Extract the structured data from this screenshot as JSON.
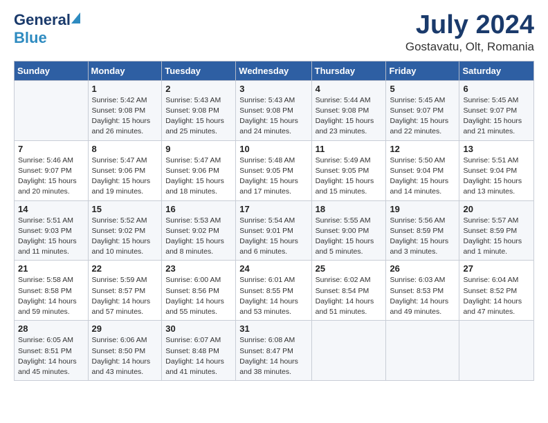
{
  "header": {
    "logo_general": "General",
    "logo_blue": "Blue",
    "title": "July 2024",
    "subtitle": "Gostavatu, Olt, Romania"
  },
  "calendar": {
    "days_of_week": [
      "Sunday",
      "Monday",
      "Tuesday",
      "Wednesday",
      "Thursday",
      "Friday",
      "Saturday"
    ],
    "weeks": [
      [
        {
          "day": "",
          "info": ""
        },
        {
          "day": "1",
          "info": "Sunrise: 5:42 AM\nSunset: 9:08 PM\nDaylight: 15 hours\nand 26 minutes."
        },
        {
          "day": "2",
          "info": "Sunrise: 5:43 AM\nSunset: 9:08 PM\nDaylight: 15 hours\nand 25 minutes."
        },
        {
          "day": "3",
          "info": "Sunrise: 5:43 AM\nSunset: 9:08 PM\nDaylight: 15 hours\nand 24 minutes."
        },
        {
          "day": "4",
          "info": "Sunrise: 5:44 AM\nSunset: 9:08 PM\nDaylight: 15 hours\nand 23 minutes."
        },
        {
          "day": "5",
          "info": "Sunrise: 5:45 AM\nSunset: 9:07 PM\nDaylight: 15 hours\nand 22 minutes."
        },
        {
          "day": "6",
          "info": "Sunrise: 5:45 AM\nSunset: 9:07 PM\nDaylight: 15 hours\nand 21 minutes."
        }
      ],
      [
        {
          "day": "7",
          "info": "Sunrise: 5:46 AM\nSunset: 9:07 PM\nDaylight: 15 hours\nand 20 minutes."
        },
        {
          "day": "8",
          "info": "Sunrise: 5:47 AM\nSunset: 9:06 PM\nDaylight: 15 hours\nand 19 minutes."
        },
        {
          "day": "9",
          "info": "Sunrise: 5:47 AM\nSunset: 9:06 PM\nDaylight: 15 hours\nand 18 minutes."
        },
        {
          "day": "10",
          "info": "Sunrise: 5:48 AM\nSunset: 9:05 PM\nDaylight: 15 hours\nand 17 minutes."
        },
        {
          "day": "11",
          "info": "Sunrise: 5:49 AM\nSunset: 9:05 PM\nDaylight: 15 hours\nand 15 minutes."
        },
        {
          "day": "12",
          "info": "Sunrise: 5:50 AM\nSunset: 9:04 PM\nDaylight: 15 hours\nand 14 minutes."
        },
        {
          "day": "13",
          "info": "Sunrise: 5:51 AM\nSunset: 9:04 PM\nDaylight: 15 hours\nand 13 minutes."
        }
      ],
      [
        {
          "day": "14",
          "info": "Sunrise: 5:51 AM\nSunset: 9:03 PM\nDaylight: 15 hours\nand 11 minutes."
        },
        {
          "day": "15",
          "info": "Sunrise: 5:52 AM\nSunset: 9:02 PM\nDaylight: 15 hours\nand 10 minutes."
        },
        {
          "day": "16",
          "info": "Sunrise: 5:53 AM\nSunset: 9:02 PM\nDaylight: 15 hours\nand 8 minutes."
        },
        {
          "day": "17",
          "info": "Sunrise: 5:54 AM\nSunset: 9:01 PM\nDaylight: 15 hours\nand 6 minutes."
        },
        {
          "day": "18",
          "info": "Sunrise: 5:55 AM\nSunset: 9:00 PM\nDaylight: 15 hours\nand 5 minutes."
        },
        {
          "day": "19",
          "info": "Sunrise: 5:56 AM\nSunset: 8:59 PM\nDaylight: 15 hours\nand 3 minutes."
        },
        {
          "day": "20",
          "info": "Sunrise: 5:57 AM\nSunset: 8:59 PM\nDaylight: 15 hours\nand 1 minute."
        }
      ],
      [
        {
          "day": "21",
          "info": "Sunrise: 5:58 AM\nSunset: 8:58 PM\nDaylight: 14 hours\nand 59 minutes."
        },
        {
          "day": "22",
          "info": "Sunrise: 5:59 AM\nSunset: 8:57 PM\nDaylight: 14 hours\nand 57 minutes."
        },
        {
          "day": "23",
          "info": "Sunrise: 6:00 AM\nSunset: 8:56 PM\nDaylight: 14 hours\nand 55 minutes."
        },
        {
          "day": "24",
          "info": "Sunrise: 6:01 AM\nSunset: 8:55 PM\nDaylight: 14 hours\nand 53 minutes."
        },
        {
          "day": "25",
          "info": "Sunrise: 6:02 AM\nSunset: 8:54 PM\nDaylight: 14 hours\nand 51 minutes."
        },
        {
          "day": "26",
          "info": "Sunrise: 6:03 AM\nSunset: 8:53 PM\nDaylight: 14 hours\nand 49 minutes."
        },
        {
          "day": "27",
          "info": "Sunrise: 6:04 AM\nSunset: 8:52 PM\nDaylight: 14 hours\nand 47 minutes."
        }
      ],
      [
        {
          "day": "28",
          "info": "Sunrise: 6:05 AM\nSunset: 8:51 PM\nDaylight: 14 hours\nand 45 minutes."
        },
        {
          "day": "29",
          "info": "Sunrise: 6:06 AM\nSunset: 8:50 PM\nDaylight: 14 hours\nand 43 minutes."
        },
        {
          "day": "30",
          "info": "Sunrise: 6:07 AM\nSunset: 8:48 PM\nDaylight: 14 hours\nand 41 minutes."
        },
        {
          "day": "31",
          "info": "Sunrise: 6:08 AM\nSunset: 8:47 PM\nDaylight: 14 hours\nand 38 minutes."
        },
        {
          "day": "",
          "info": ""
        },
        {
          "day": "",
          "info": ""
        },
        {
          "day": "",
          "info": ""
        }
      ]
    ]
  }
}
